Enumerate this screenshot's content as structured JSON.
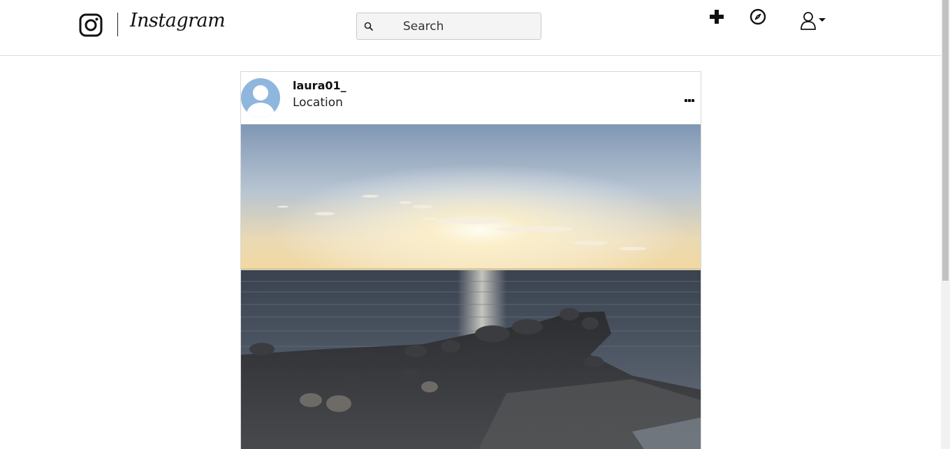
{
  "header": {
    "brand": "Instagram",
    "search_placeholder": "Search"
  },
  "post": {
    "username": "laura01_",
    "location": "Location"
  },
  "icons": {
    "logo": "instagram-glyph-icon",
    "search": "magnifier-icon",
    "new_post": "plus-icon",
    "explore": "compass-icon",
    "profile": "user-icon",
    "more": "ellipsis-icon"
  },
  "colors": {
    "avatar_bg": "#8fb6dd",
    "border": "#d6d6d6",
    "search_bg": "#f4f4f4"
  }
}
